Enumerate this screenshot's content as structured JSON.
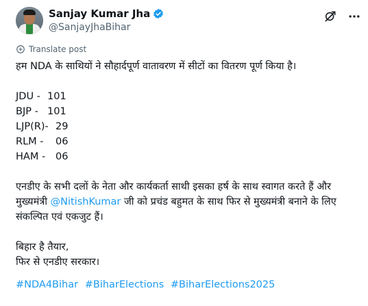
{
  "author": {
    "name": "Sanjay Kumar Jha",
    "handle": "@SanjayJhaBihar"
  },
  "icons": {
    "verified": "verified-badge-icon",
    "grok": "grok-icon",
    "more": "more-icon",
    "translate": "translate-icon"
  },
  "translate_label": "Translate post",
  "post": {
    "intro": "हम NDA के साथियों ने सौहार्दपूर्ण वातावरण में सीटों का वितरण पूर्ण किया है।",
    "seats": [
      {
        "party": "JDU -",
        "count": "101"
      },
      {
        "party": "BJP -",
        "count": "101"
      },
      {
        "party": "LJP(R)-",
        "count": "29"
      },
      {
        "party": "RLM -",
        "count": "06"
      },
      {
        "party": "HAM -",
        "count": "06"
      }
    ],
    "para2_a": "एनडीए के सभी दलों के नेता और कार्यकर्ता साथी इसका हर्ष के साथ स्वागत करते हैं और",
    "para2_b_pre": "मुख्यमंत्री ",
    "mention": "@NitishKumar",
    "para2_b_post": " जी को प्रचंड बहुमत के साथ फिर से मुख्यमंत्री बनाने के लिए",
    "para2_c": "संकल्पित एवं एकजुट हैं।",
    "closing1": "बिहार है तैयार,",
    "closing2": "फिर से एनडीए सरकार।",
    "hashtags": [
      "#NDA4Bihar",
      "#BiharElections",
      "#BiharElections2025"
    ]
  },
  "colors": {
    "accent": "#1d9bf0",
    "text": "#0f1419",
    "muted": "#536471"
  }
}
